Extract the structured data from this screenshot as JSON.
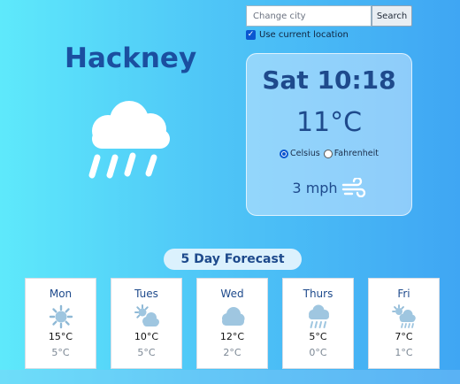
{
  "search": {
    "placeholder": "Change city",
    "button_label": "Search"
  },
  "location": {
    "label": "Use current location",
    "checked": true
  },
  "city": "Hackney",
  "current": {
    "icon": "rain-cloud-icon",
    "datetime": "Sat 10:18",
    "temperature": "11°C",
    "units": {
      "celsius_label": "Celsius",
      "fahrenheit_label": "Fahrenheit",
      "selected": "Celsius"
    },
    "wind": "3 mph",
    "wind_icon": "wind-icon"
  },
  "forecast": {
    "title": "5 Day Forecast",
    "days": [
      {
        "name": "Mon",
        "icon": "sun-icon",
        "high": "15°C",
        "low": "5°C"
      },
      {
        "name": "Tues",
        "icon": "sun-cloud-icon",
        "high": "10°C",
        "low": "5°C"
      },
      {
        "name": "Wed",
        "icon": "cloud-icon",
        "high": "12°C",
        "low": "2°C"
      },
      {
        "name": "Thurs",
        "icon": "rain-cloud-icon",
        "high": "5°C",
        "low": "0°C"
      },
      {
        "name": "Fri",
        "icon": "sun-rain-cloud-icon",
        "high": "7°C",
        "low": "1°C"
      }
    ]
  },
  "colors": {
    "accent": "#1e4a8c",
    "city": "#1b4fa0",
    "icon_fill": "#9fc6e0"
  }
}
